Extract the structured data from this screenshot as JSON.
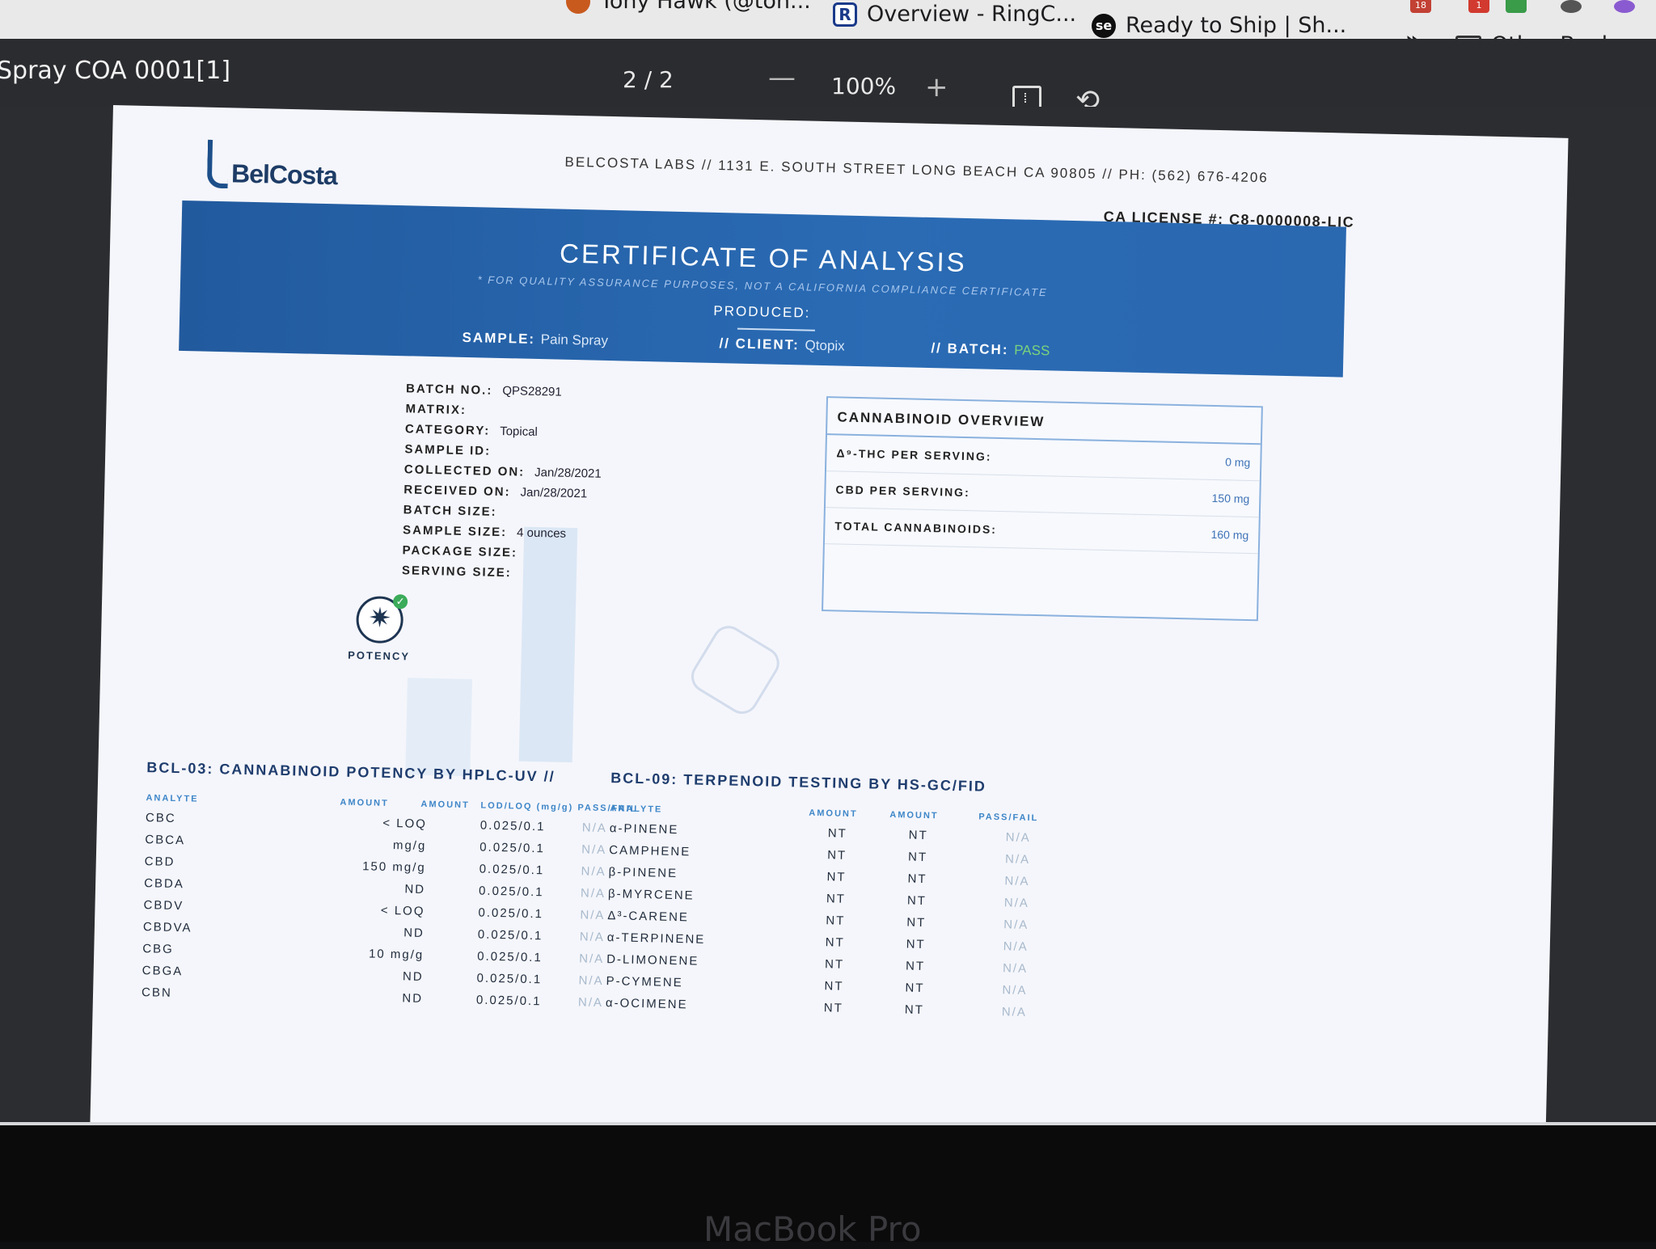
{
  "bookmarks": {
    "items": [
      {
        "label": "Tony Hawk (@ton..."
      },
      {
        "label": "Overview - RingC..."
      },
      {
        "label": "Ready to Ship | Sh..."
      }
    ],
    "more": "»",
    "other": "Other Bookmarks",
    "ext_badges": [
      "18",
      "1"
    ]
  },
  "toolbar": {
    "title": "Spray COA 0001[1]",
    "page_indicator": "2 / 2",
    "zoom_out": "—",
    "zoom": "100%",
    "zoom_in": "+"
  },
  "document": {
    "logo": "BelCosta",
    "address": "BELCOSTA LABS // 1131 E. SOUTH STREET LONG BEACH CA 90805 // PH: (562) 676-4206",
    "license": "CA LICENSE #: C8-0000008-LIC",
    "banner": {
      "title": "CERTIFICATE OF ANALYSIS",
      "subtitle": "* FOR QUALITY ASSURANCE PURPOSES, NOT A CALIFORNIA COMPLIANCE CERTIFICATE",
      "produced": "PRODUCED:",
      "sample_label": "SAMPLE:",
      "sample_value": "Pain Spray",
      "client_label": "// CLIENT:",
      "client_value": "Qtopix",
      "batch_label": "// BATCH:",
      "batch_value": "PASS"
    },
    "info": [
      {
        "label": "BATCH NO.:",
        "value": "QPS28291"
      },
      {
        "label": "MATRIX:",
        "value": ""
      },
      {
        "label": "CATEGORY:",
        "value": "Topical"
      },
      {
        "label": "SAMPLE ID:",
        "value": ""
      },
      {
        "label": "COLLECTED ON:",
        "value": "Jan/28/2021"
      },
      {
        "label": "RECEIVED ON:",
        "value": "Jan/28/2021"
      },
      {
        "label": "BATCH SIZE:",
        "value": ""
      },
      {
        "label": "SAMPLE SIZE:",
        "value": "4 ounces"
      },
      {
        "label": "PACKAGE SIZE:",
        "value": ""
      },
      {
        "label": "SERVING SIZE:",
        "value": ""
      }
    ],
    "overview": {
      "title": "CANNABINOID OVERVIEW",
      "rows": [
        {
          "label": "Δ⁹-THC PER SERVING:",
          "value": "0 mg"
        },
        {
          "label": "CBD PER SERVING:",
          "value": "150 mg"
        },
        {
          "label": "TOTAL CANNABINOIDS:",
          "value": "160 mg"
        }
      ]
    },
    "potency_label": "POTENCY",
    "cannabinoid_section": {
      "title": "BCL-03: CANNABINOID POTENCY BY HPLC-UV //",
      "headers": [
        "ANALYTE",
        "AMOUNT",
        "AMOUNT",
        "LOD/LOQ (mg/g)",
        "PASS/FAIL"
      ],
      "rows": [
        {
          "analyte": "CBC",
          "amount": "< LOQ",
          "lod": "0.025/0.1",
          "pass": "N/A"
        },
        {
          "analyte": "CBCA",
          "amount": "mg/g",
          "lod": "0.025/0.1",
          "pass": "N/A"
        },
        {
          "analyte": "CBD",
          "amount": "150 mg/g",
          "lod": "0.025/0.1",
          "pass": "N/A"
        },
        {
          "analyte": "CBDA",
          "amount": "ND",
          "lod": "0.025/0.1",
          "pass": "N/A"
        },
        {
          "analyte": "CBDV",
          "amount": "< LOQ",
          "lod": "0.025/0.1",
          "pass": "N/A"
        },
        {
          "analyte": "CBDVA",
          "amount": "ND",
          "lod": "0.025/0.1",
          "pass": "N/A"
        },
        {
          "analyte": "CBG",
          "amount": "10 mg/g",
          "lod": "0.025/0.1",
          "pass": "N/A"
        },
        {
          "analyte": "CBGA",
          "amount": "ND",
          "lod": "0.025/0.1",
          "pass": "N/A"
        },
        {
          "analyte": "CBN",
          "amount": "ND",
          "lod": "0.025/0.1",
          "pass": "N/A"
        }
      ]
    },
    "terpene_section": {
      "title": "BCL-09: TERPENOID TESTING BY HS-GC/FID",
      "headers": [
        "ANALYTE",
        "AMOUNT",
        "AMOUNT",
        "PASS/FAIL"
      ],
      "rows": [
        {
          "analyte": "α-PINENE",
          "a1": "NT",
          "a2": "NT",
          "pass": "N/A"
        },
        {
          "analyte": "CAMPHENE",
          "a1": "NT",
          "a2": "NT",
          "pass": "N/A"
        },
        {
          "analyte": "β-PINENE",
          "a1": "NT",
          "a2": "NT",
          "pass": "N/A"
        },
        {
          "analyte": "β-MYRCENE",
          "a1": "NT",
          "a2": "NT",
          "pass": "N/A"
        },
        {
          "analyte": "Δ³-CARENE",
          "a1": "NT",
          "a2": "NT",
          "pass": "N/A"
        },
        {
          "analyte": "α-TERPINENE",
          "a1": "NT",
          "a2": "NT",
          "pass": "N/A"
        },
        {
          "analyte": "D-LIMONENE",
          "a1": "NT",
          "a2": "NT",
          "pass": "N/A"
        },
        {
          "analyte": "P-CYMENE",
          "a1": "NT",
          "a2": "NT",
          "pass": "N/A"
        },
        {
          "analyte": "α-OCIMENE",
          "a1": "NT",
          "a2": "NT",
          "pass": "N/A"
        }
      ]
    }
  },
  "device_label": "MacBook Pro",
  "colors": {
    "banner": "#2a68b0",
    "accent": "#3e86c8",
    "pass": "#7ad37c"
  }
}
